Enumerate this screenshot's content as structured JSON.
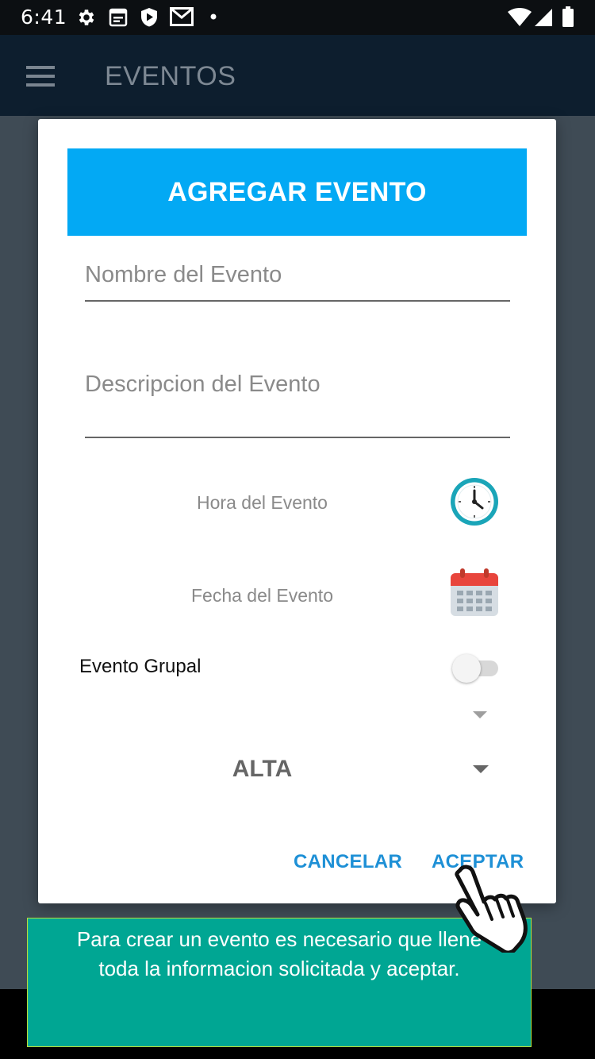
{
  "status_bar": {
    "time": "6:41",
    "left_icons": [
      "gear-icon",
      "calendar-note-icon",
      "shield-play-icon",
      "gmail-icon",
      "dot-icon"
    ],
    "right_icons": [
      "wifi-icon",
      "signal-icon",
      "battery-icon"
    ]
  },
  "app_bar": {
    "title": "EVENTOS",
    "menu_icon": "hamburger-menu-icon"
  },
  "dialog": {
    "title": "AGREGAR EVENTO",
    "name_placeholder": "Nombre del Evento",
    "description_placeholder": "Descripcion del Evento",
    "time_label": "Hora del Evento",
    "time_icon": "clock-icon",
    "date_label": "Fecha del Evento",
    "date_icon": "calendar-icon",
    "group_label": "Evento Grupal",
    "group_switch_on": false,
    "priority_value": "ALTA",
    "cancel_label": "CANCELAR",
    "accept_label": "ACEPTAR",
    "header_color": "#03a9f4",
    "button_color": "#1e90d6"
  },
  "tooltip": {
    "text": "Para crear un evento es necesario que llene toda la informacion solicitada y aceptar.",
    "background": "#00a693",
    "pointer_icon": "hand-pointer-icon"
  }
}
